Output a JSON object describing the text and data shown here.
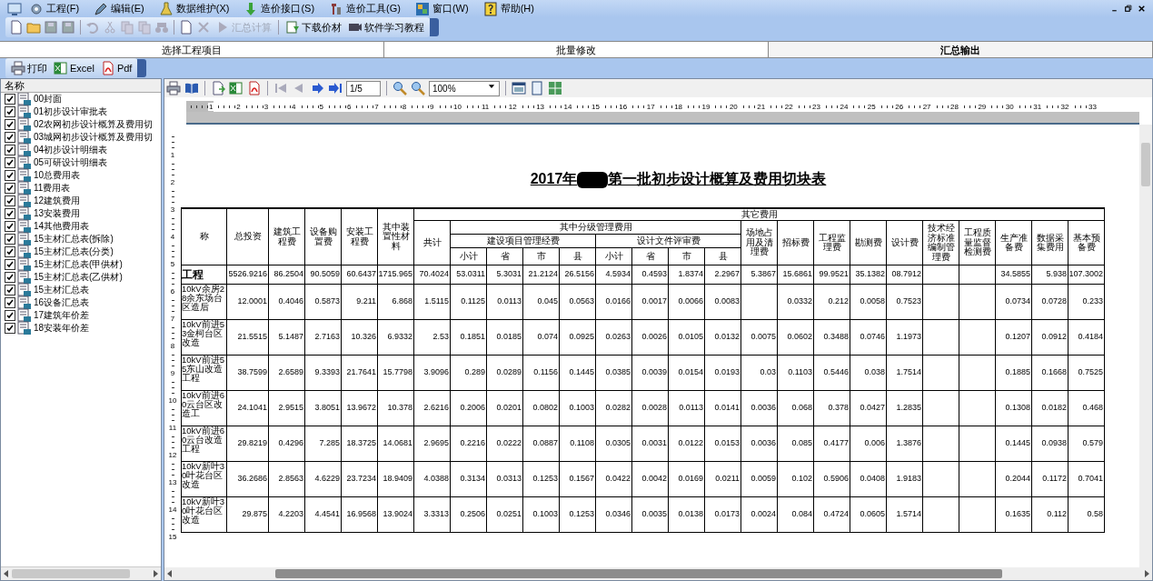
{
  "menu": [
    "工程(F)",
    "编辑(E)",
    "数据维护(X)",
    "造价接口(S)",
    "造价工具(G)",
    "窗口(W)",
    "帮助(H)"
  ],
  "toolbar": {
    "calc_button": {
      "label": "汇总计算",
      "disabled": true
    },
    "download_button": "下载价材",
    "tutorial_button": "软件学习教程"
  },
  "tabs": [
    {
      "label": "选择工程项目",
      "selected": false
    },
    {
      "label": "批量修改",
      "selected": false
    },
    {
      "label": "汇总输出",
      "selected": true
    }
  ],
  "export_toolbar": [
    "打印",
    "Excel",
    "Pdf"
  ],
  "tree": {
    "header": "名称",
    "items": [
      {
        "label": "00封面",
        "checked": true
      },
      {
        "label": "01初步设计审批表",
        "checked": true
      },
      {
        "label": "02农网初步设计概算及费用切",
        "checked": true
      },
      {
        "label": "03城网初步设计概算及费用切",
        "checked": true
      },
      {
        "label": "04初步设计明细表",
        "checked": true
      },
      {
        "label": "05可研设计明细表",
        "checked": true
      },
      {
        "label": "10总费用表",
        "checked": true
      },
      {
        "label": "11费用表",
        "checked": true
      },
      {
        "label": "12建筑费用",
        "checked": true
      },
      {
        "label": "13安装费用",
        "checked": true
      },
      {
        "label": "14其他费用表",
        "checked": true
      },
      {
        "label": "15主材汇总表(拆除)",
        "checked": true
      },
      {
        "label": "15主材汇总表(分类)",
        "checked": true
      },
      {
        "label": "15主材汇总表(甲供材)",
        "checked": true
      },
      {
        "label": "15主材汇总表(乙供材)",
        "checked": true
      },
      {
        "label": "15主材汇总表",
        "checked": true
      },
      {
        "label": "16设备汇总表",
        "checked": true
      },
      {
        "label": "17建筑年价差",
        "checked": true
      },
      {
        "label": "18安装年价差",
        "checked": true
      }
    ]
  },
  "report_toolbar": {
    "page": "1/5",
    "zoom": "100%"
  },
  "ruler": {
    "horizontal": [
      "1",
      "2",
      "3",
      "4",
      "5",
      "6",
      "7",
      "8",
      "9",
      "10",
      "11",
      "12",
      "13",
      "14",
      "15",
      "16",
      "17",
      "18",
      "19",
      "20",
      "21",
      "22",
      "23",
      "24",
      "25",
      "26",
      "27",
      "28",
      "29",
      "30",
      "31",
      "32",
      "33"
    ],
    "vertical": [
      "1",
      "2",
      "3",
      "4",
      "5",
      "6",
      "7",
      "8",
      "9",
      "10",
      "11",
      "12",
      "13",
      "14",
      "15"
    ]
  },
  "report": {
    "title_prefix": "2017年",
    "title_suffix": "第一批初步设计概算及费用切块表",
    "table": {
      "lead_columns": [
        "称",
        "总投资",
        "建筑工程费",
        "设备购置费",
        "安装工程费",
        "其中装置性材料"
      ],
      "group_header": "其它费用",
      "total_column": "共计",
      "sub_group_header": "其中分级管理费用",
      "sub_groups": [
        "建设项目管理经费",
        "设计文件评审费"
      ],
      "sub_columns": [
        "小计",
        "省",
        "市",
        "县",
        "小计",
        "省",
        "市",
        "县"
      ],
      "after_columns": [
        "场地占用及清理费",
        "招标费",
        "工程监理费",
        "勘测费",
        "设计费",
        "技术经济标准编制管理费",
        "工程质量监督检测费",
        "生产准备费",
        "数据采集费用",
        "基本预备费"
      ],
      "rows": [
        {
          "kind": "total",
          "name": "工程",
          "cells": [
            "5526.9216",
            "86.2504",
            "90.5059",
            "60.6437",
            "1715.965",
            "70.4024",
            "53.0311",
            "5.3031",
            "21.2124",
            "26.5156",
            "4.5934",
            "0.4593",
            "1.8374",
            "2.2967",
            "5.3867",
            "15.6861",
            "99.9521",
            "35.1382",
            "08.7912",
            null,
            null,
            "34.5855",
            "5.938",
            "107.3002"
          ]
        },
        {
          "kind": "item",
          "name": "10kV余房28余东场台区造后",
          "cells": [
            "12.0001",
            "0.4046",
            "0.5873",
            "9.211",
            "6.868",
            "1.5115",
            "0.1125",
            "0.0113",
            "0.045",
            "0.0563",
            "0.0166",
            "0.0017",
            "0.0066",
            "0.0083",
            null,
            "0.0332",
            "0.212",
            "0.0058",
            "0.7523",
            null,
            null,
            "0.0734",
            "0.0728",
            "0.233"
          ]
        },
        {
          "kind": "item",
          "name": "10kV前进53金柯台区改造",
          "cells": [
            "21.5515",
            "5.1487",
            "2.7163",
            "10.326",
            "6.9332",
            "2.53",
            "0.1851",
            "0.0185",
            "0.074",
            "0.0925",
            "0.0263",
            "0.0026",
            "0.0105",
            "0.0132",
            "0.0075",
            "0.0602",
            "0.3488",
            "0.0746",
            "1.1973",
            null,
            null,
            "0.1207",
            "0.0912",
            "0.4184"
          ]
        },
        {
          "kind": "item",
          "name": "10kV前进55东山改造工程",
          "cells": [
            "38.7599",
            "2.6589",
            "9.3393",
            "21.7641",
            "15.7798",
            "3.9096",
            "0.289",
            "0.0289",
            "0.1156",
            "0.1445",
            "0.0385",
            "0.0039",
            "0.0154",
            "0.0193",
            "0.03",
            "0.1103",
            "0.5446",
            "0.038",
            "1.7514",
            null,
            null,
            "0.1885",
            "0.1668",
            "0.7525"
          ]
        },
        {
          "kind": "item",
          "name": "10kV前进60云台区改造工",
          "cells": [
            "24.1041",
            "2.9515",
            "3.8051",
            "13.9672",
            "10.378",
            "2.6216",
            "0.2006",
            "0.0201",
            "0.0802",
            "0.1003",
            "0.0282",
            "0.0028",
            "0.0113",
            "0.0141",
            "0.0036",
            "0.068",
            "0.378",
            "0.0427",
            "1.2835",
            null,
            null,
            "0.1308",
            "0.0182",
            "0.468"
          ]
        },
        {
          "kind": "item",
          "name": "10kV前进60云台改造工程",
          "cells": [
            "29.8219",
            "0.4296",
            "7.285",
            "18.3725",
            "14.0681",
            "2.9695",
            "0.2216",
            "0.0222",
            "0.0887",
            "0.1108",
            "0.0305",
            "0.0031",
            "0.0122",
            "0.0153",
            "0.0036",
            "0.085",
            "0.4177",
            "0.006",
            "1.3876",
            null,
            null,
            "0.1445",
            "0.0938",
            "0.579"
          ]
        },
        {
          "kind": "item",
          "name": "10kV新叶30叶花台区改造",
          "cells": [
            "36.2686",
            "2.8563",
            "4.6229",
            "23.7234",
            "18.9409",
            "4.0388",
            "0.3134",
            "0.0313",
            "0.1253",
            "0.1567",
            "0.0422",
            "0.0042",
            "0.0169",
            "0.0211",
            "0.0059",
            "0.102",
            "0.5906",
            "0.0408",
            "1.9183",
            null,
            null,
            "0.2044",
            "0.1172",
            "0.7041"
          ]
        },
        {
          "kind": "item",
          "name": "10kV新叶30叶花台区改造",
          "cells": [
            "29.875",
            "4.2203",
            "4.4541",
            "16.9568",
            "13.9024",
            "3.3313",
            "0.2506",
            "0.0251",
            "0.1003",
            "0.1253",
            "0.0346",
            "0.0035",
            "0.0138",
            "0.0173",
            "0.0024",
            "0.084",
            "0.4724",
            "0.0605",
            "1.5714",
            null,
            null,
            "0.1635",
            "0.112",
            "0.58"
          ]
        }
      ]
    }
  }
}
